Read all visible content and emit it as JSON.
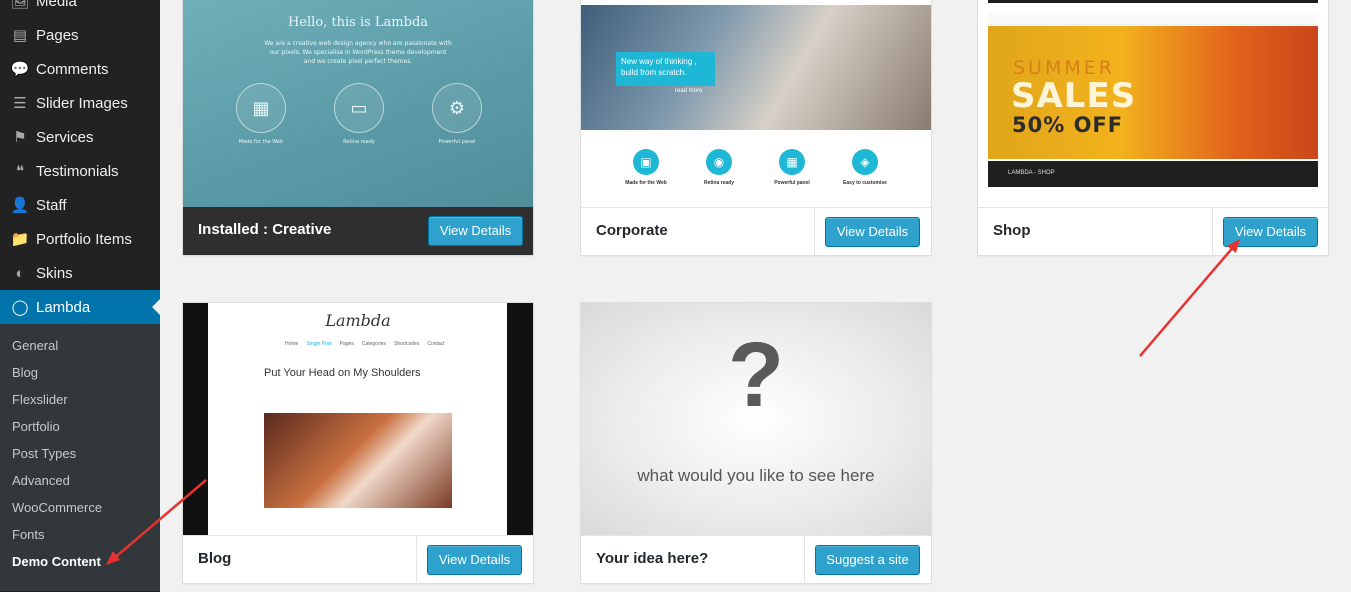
{
  "sidebar": {
    "menu": [
      {
        "label": "Media",
        "icon": "media-icon",
        "glyph": "🖼"
      },
      {
        "label": "Pages",
        "icon": "pages-icon",
        "glyph": "▤"
      },
      {
        "label": "Comments",
        "icon": "comments-icon",
        "glyph": "💬"
      },
      {
        "label": "Slider Images",
        "icon": "slider-images-icon",
        "glyph": "☰"
      },
      {
        "label": "Services",
        "icon": "services-icon",
        "glyph": "⚑"
      },
      {
        "label": "Testimonials",
        "icon": "testimonials-icon",
        "glyph": "❝"
      },
      {
        "label": "Staff",
        "icon": "staff-icon",
        "glyph": "👤"
      },
      {
        "label": "Portfolio Items",
        "icon": "portfolio-items-icon",
        "glyph": "📁"
      },
      {
        "label": "Skins",
        "icon": "skins-icon",
        "glyph": "◐"
      },
      {
        "label": "Lambda",
        "icon": "lambda-icon",
        "glyph": "◯"
      }
    ],
    "submenu": [
      {
        "label": "General"
      },
      {
        "label": "Blog"
      },
      {
        "label": "Flexslider"
      },
      {
        "label": "Portfolio"
      },
      {
        "label": "Post Types"
      },
      {
        "label": "Advanced"
      },
      {
        "label": "WooCommerce"
      },
      {
        "label": "Fonts"
      },
      {
        "label": "Demo Content"
      }
    ]
  },
  "cards": {
    "creative": {
      "prefix": "Installed : ",
      "title": "Creative",
      "button": "View Details",
      "shot": {
        "heading": "Hello, this is Lambda",
        "intro": "We are a creative web design agency who are passionate with our pixels. We specialise in WordPress theme development and we create pixel perfect themes.",
        "features": [
          "Made for the Web",
          "Retina ready",
          "Powerful panel"
        ]
      }
    },
    "corporate": {
      "title": "Corporate",
      "button": "View Details",
      "shot": {
        "slogan": "New way of thinking , build from scratch.",
        "read_more": "read more",
        "features": [
          "Made for the Web",
          "Retina ready",
          "Powerful panel",
          "Easy to customise"
        ]
      }
    },
    "shop": {
      "title": "Shop",
      "button": "View Details",
      "shot": {
        "line1": "SUMMER",
        "line2": "SALES",
        "line3": "50% OFF",
        "brand": "LAMBDA - SHOP"
      }
    },
    "blog": {
      "title": "Blog",
      "button": "View Details",
      "shot": {
        "logo": "Lambda",
        "nav": [
          "Home",
          "Single Post",
          "Pages",
          "Categories",
          "Shortcodes",
          "Contact"
        ],
        "post_title": "Put Your Head on My Shoulders"
      }
    },
    "idea": {
      "title": "Your idea here?",
      "button": "Suggest a site",
      "shot": {
        "mark": "?",
        "caption": "what would you like to see here"
      }
    }
  },
  "colors": {
    "sidebar_bg": "#222222",
    "active_menu": "#0073aa",
    "button": "#2ea2cc",
    "arrow": "#e8322f"
  }
}
